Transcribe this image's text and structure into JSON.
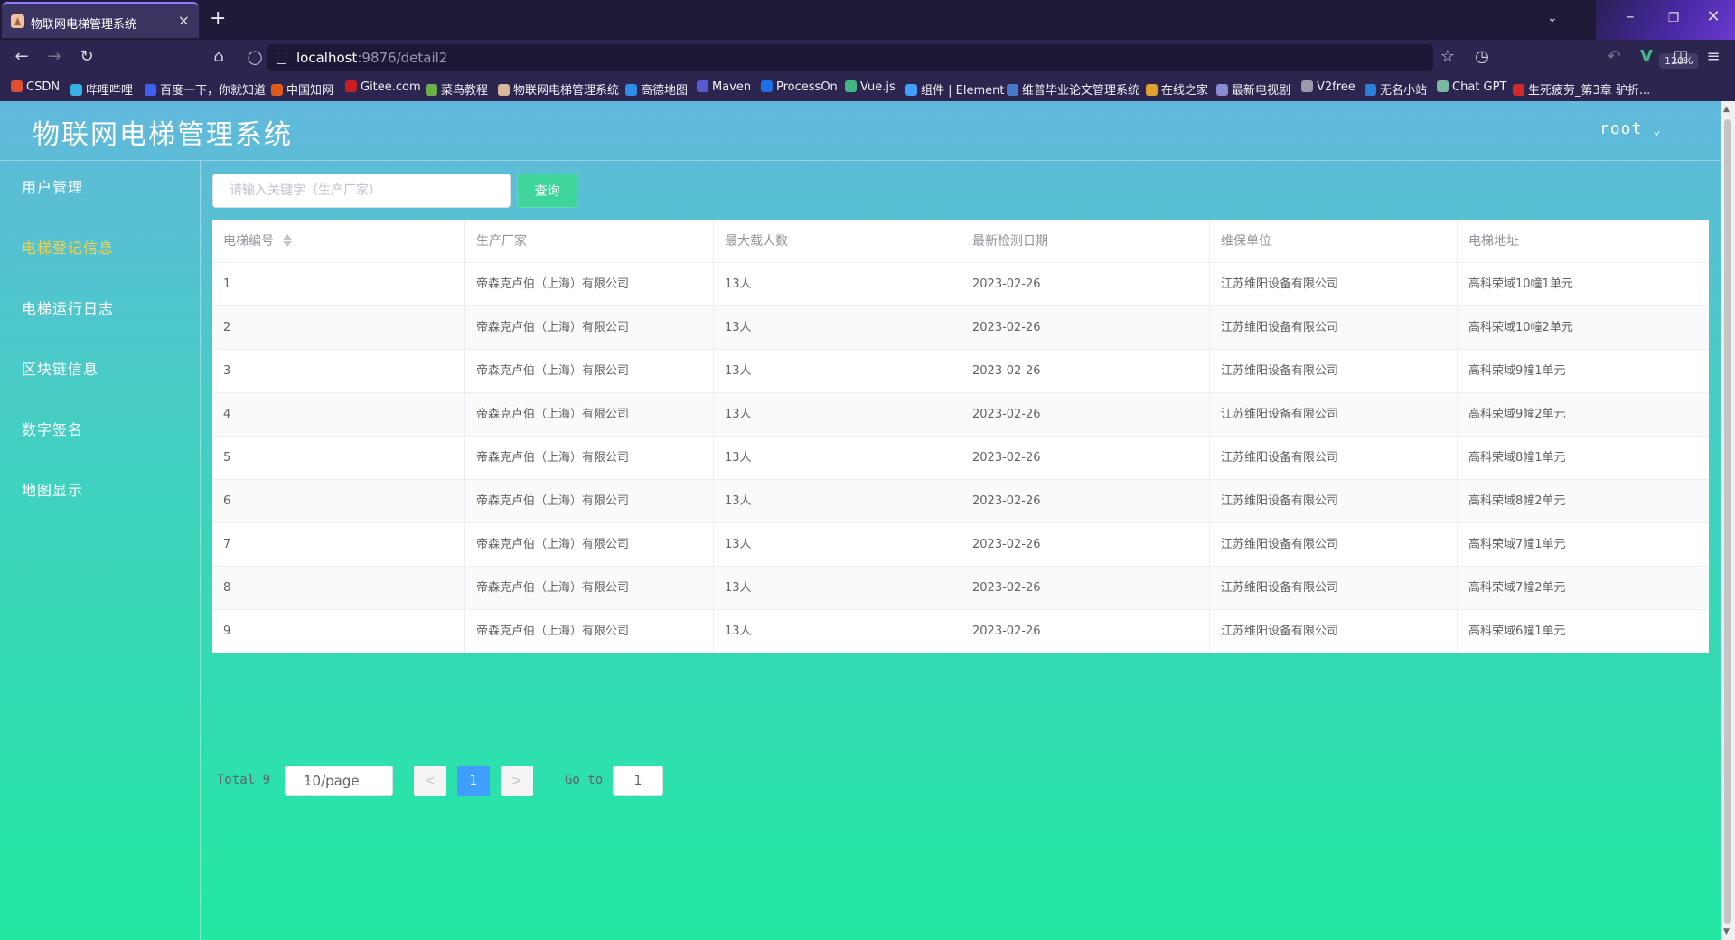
{
  "browser": {
    "tab_title": "物联网电梯管理系统",
    "tab_close": "×",
    "new_tab": "+",
    "url_host": "localhost",
    "url_path": ":9876/detail2",
    "zoom": "120%",
    "bookmarks": [
      {
        "label": "CSDN",
        "color": "#e04d31"
      },
      {
        "label": "哔哩哔哩",
        "color": "#3ab0e2"
      },
      {
        "label": "百度一下，你就知道",
        "color": "#3d62f0"
      },
      {
        "label": "中国知网",
        "color": "#e05a1a"
      },
      {
        "label": "Gitee.com",
        "color": "#c71d23"
      },
      {
        "label": "菜鸟教程",
        "color": "#6bb14a"
      },
      {
        "label": "物联网电梯管理系统",
        "color": "#d8b89a"
      },
      {
        "label": "高德地图",
        "color": "#2e8de6"
      },
      {
        "label": "Maven",
        "color": "#5a5ad0"
      },
      {
        "label": "ProcessOn",
        "color": "#1f6fe6"
      },
      {
        "label": "Vue.js",
        "color": "#41b883"
      },
      {
        "label": "组件 | Element",
        "color": "#409eff"
      },
      {
        "label": "维普毕业论文管理系统",
        "color": "#4a78c8"
      },
      {
        "label": "在线之家",
        "color": "#e0a030"
      },
      {
        "label": "最新电视剧",
        "color": "#8a8ad0"
      },
      {
        "label": "V2free",
        "color": "#9a9aaa"
      },
      {
        "label": "无名小站",
        "color": "#2a80d8"
      },
      {
        "label": "Chat GPT",
        "color": "#7ab8a0"
      },
      {
        "label": "生死疲劳_第3章 驴折...",
        "color": "#d02a2a"
      }
    ]
  },
  "app": {
    "title": "物联网电梯管理系统",
    "user": "root"
  },
  "sidebar": {
    "items": [
      {
        "label": "用户管理",
        "active": false
      },
      {
        "label": "电梯登记信息",
        "active": true
      },
      {
        "label": "电梯运行日志",
        "active": false
      },
      {
        "label": "区块链信息",
        "active": false
      },
      {
        "label": "数字签名",
        "active": false
      },
      {
        "label": "地图显示",
        "active": false
      }
    ]
  },
  "search": {
    "placeholder": "请输入关键字（生产厂家）",
    "button": "查询"
  },
  "table": {
    "headers": [
      "电梯编号",
      "生产厂家",
      "最大载人数",
      "最新检测日期",
      "维保单位",
      "电梯地址"
    ],
    "rows": [
      [
        "1",
        "帝森克卢伯（上海）有限公司",
        "13人",
        "2023-02-26",
        "江苏维阳设备有限公司",
        "高科荣域10幢1单元"
      ],
      [
        "2",
        "帝森克卢伯（上海）有限公司",
        "13人",
        "2023-02-26",
        "江苏维阳设备有限公司",
        "高科荣域10幢2单元"
      ],
      [
        "3",
        "帝森克卢伯（上海）有限公司",
        "13人",
        "2023-02-26",
        "江苏维阳设备有限公司",
        "高科荣域9幢1单元"
      ],
      [
        "4",
        "帝森克卢伯（上海）有限公司",
        "13人",
        "2023-02-26",
        "江苏维阳设备有限公司",
        "高科荣域9幢2单元"
      ],
      [
        "5",
        "帝森克卢伯（上海）有限公司",
        "13人",
        "2023-02-26",
        "江苏维阳设备有限公司",
        "高科荣域8幢1单元"
      ],
      [
        "6",
        "帝森克卢伯（上海）有限公司",
        "13人",
        "2023-02-26",
        "江苏维阳设备有限公司",
        "高科荣域8幢2单元"
      ],
      [
        "7",
        "帝森克卢伯（上海）有限公司",
        "13人",
        "2023-02-26",
        "江苏维阳设备有限公司",
        "高科荣域7幢1单元"
      ],
      [
        "8",
        "帝森克卢伯（上海）有限公司",
        "13人",
        "2023-02-26",
        "江苏维阳设备有限公司",
        "高科荣域7幢2单元"
      ],
      [
        "9",
        "帝森克卢伯（上海）有限公司",
        "13人",
        "2023-02-26",
        "江苏维阳设备有限公司",
        "高科荣域6幢1单元"
      ]
    ]
  },
  "pagination": {
    "total": "Total 9",
    "page_size": "10/page",
    "prev": "<",
    "current": "1",
    "next": ">",
    "goto_label": "Go to",
    "goto_value": "1"
  }
}
